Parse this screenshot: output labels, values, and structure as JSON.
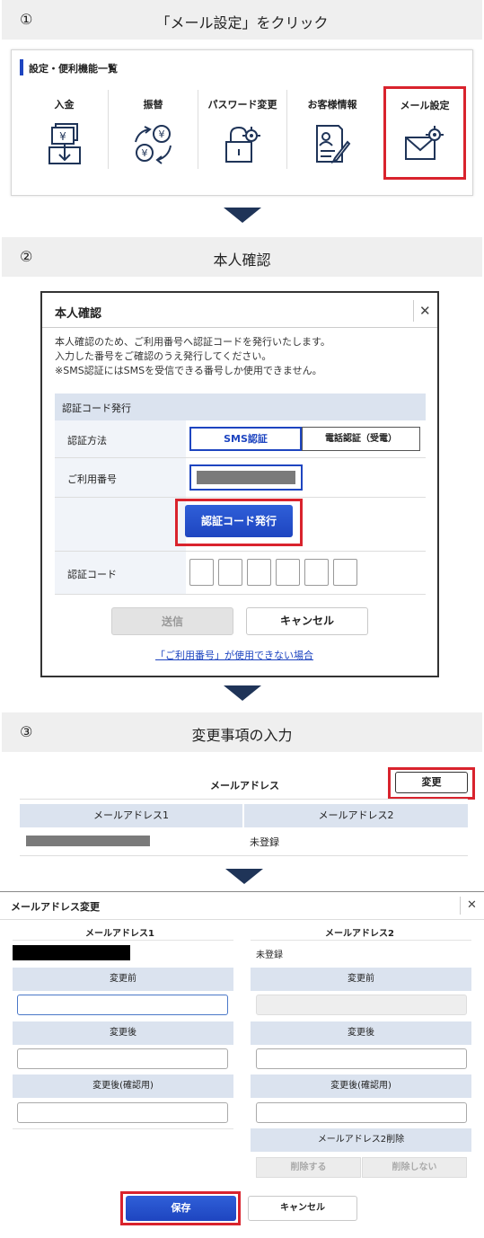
{
  "step1": {
    "num": "①",
    "title": "「メール設定」をクリック"
  },
  "step2": {
    "num": "②",
    "title": "本人確認"
  },
  "step3": {
    "num": "③",
    "title": "変更事項の入力"
  },
  "menu": {
    "heading": "設定・便利機能一覧",
    "items": [
      {
        "label": "入金",
        "icon": "deposit-icon"
      },
      {
        "label": "振替",
        "icon": "transfer-icon"
      },
      {
        "label": "パスワード変更",
        "icon": "password-change-icon"
      },
      {
        "label": "お客様情報",
        "icon": "customer-info-icon"
      },
      {
        "label": "メール設定",
        "icon": "mail-settings-icon"
      }
    ]
  },
  "verify": {
    "title": "本人確認",
    "close": "✕",
    "desc1": "本人確認のため、ご利用番号へ認証コードを発行いたします。",
    "desc2": "入力した番号をご確認のうえ発行してください。",
    "desc3": "※SMS認証にはSMSを受信できる番号しか使用できません。",
    "section": "認証コード発行",
    "method_label": "認証方法",
    "sms": "SMS認証",
    "phone": "電話認証（受電）",
    "number_label": "ご利用番号",
    "issue_button": "認証コード発行",
    "code_label": "認証コード",
    "send": "送信",
    "cancel": "キャンセル",
    "help_link": "「ご利用番号」が使用できない場合"
  },
  "mail_summary": {
    "title": "メールアドレス",
    "change": "変更",
    "col1": "メールアドレス1",
    "col2": "メールアドレス2",
    "val2": "未登録"
  },
  "mail_edit": {
    "title": "メールアドレス変更",
    "close": "✕",
    "col1": "メールアドレス1",
    "col2": "メールアドレス2",
    "val2": "未登録",
    "before": "変更前",
    "after": "変更後",
    "after_confirm": "変更後(確認用)",
    "delete_section": "メールアドレス2削除",
    "delete_yes": "削除する",
    "delete_no": "削除しない",
    "save": "保存",
    "cancel": "キャンセル"
  },
  "colors": {
    "accent": "#1e45c0",
    "highlight": "#d9232d",
    "navy": "#1f3458"
  }
}
